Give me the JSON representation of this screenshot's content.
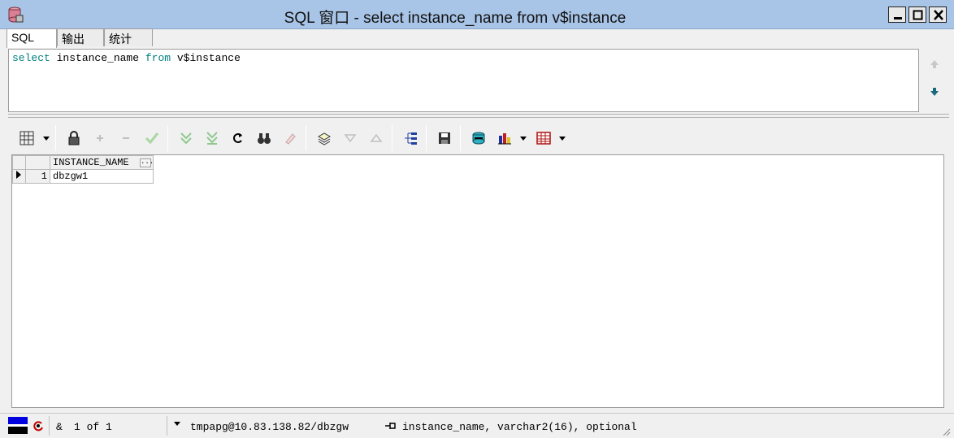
{
  "window": {
    "title": "SQL 窗口 - select instance_name from v$instance",
    "icon": "database-icon",
    "controls": [
      "minimize-icon",
      "maximize-icon",
      "close-icon"
    ]
  },
  "tabs": [
    {
      "label": "SQL",
      "active": true
    },
    {
      "label": "输出",
      "active": false
    },
    {
      "label": "统计",
      "active": false
    }
  ],
  "editor": {
    "tokens": [
      {
        "text": "select",
        "kind": "keyword"
      },
      {
        "text": " instance_name ",
        "kind": "identifier"
      },
      {
        "text": "from",
        "kind": "keyword"
      },
      {
        "text": " v$instance",
        "kind": "identifier"
      }
    ],
    "keyword_color": "#008080"
  },
  "toolbar": {
    "icons": [
      "grid-view-icon",
      "lock-icon",
      "add-record-icon",
      "delete-record-icon",
      "post-changes-icon",
      "fetch-next-icon",
      "fetch-all-icon",
      "refresh-icon",
      "find-icon",
      "clear-icon",
      "query-by-example-icon",
      "next-record-icon",
      "previous-record-icon",
      "show-tree-icon",
      "save-icon",
      "export-icon",
      "chart-icon",
      "spreadsheet-icon"
    ]
  },
  "grid": {
    "columns": [
      "INSTANCE_NAME"
    ],
    "rows": [
      {
        "num": "1",
        "cells": [
          "dbzgw1"
        ]
      }
    ]
  },
  "status": {
    "record": "1 of 1",
    "amp": "&",
    "connection": "tmpapg@10.83.138.82/dbzgw",
    "field_info": "instance_name, varchar2(16), optional"
  }
}
